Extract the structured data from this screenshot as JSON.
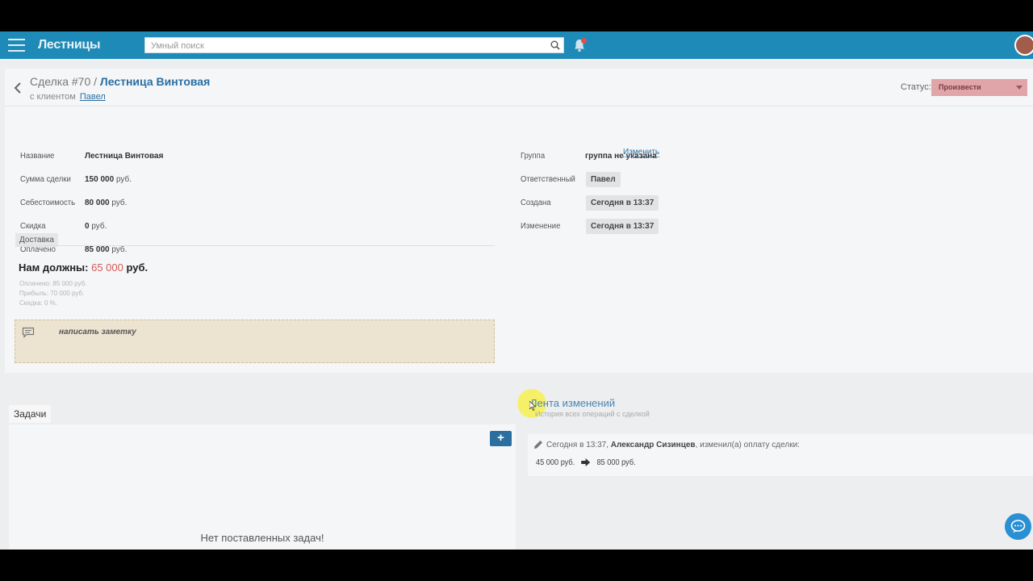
{
  "header": {
    "title": "Лестницы",
    "search_placeholder": "Умный поиск"
  },
  "deal": {
    "title_prefix": "Сделка #70 /",
    "title_name": "Лестница Винтовая",
    "client_label": "с клиентом",
    "client_name": "Павел",
    "status_label": "Статус:",
    "status_value": "Произвести",
    "status_color": "#dfa5a8"
  },
  "fields_left": [
    {
      "label": "Название",
      "value": "Лестница Винтовая",
      "unit": ""
    },
    {
      "label": "Сумма сделки",
      "value": "150 000",
      "unit": "руб."
    },
    {
      "label": "Себестоимость",
      "value": "80 000",
      "unit": "руб."
    },
    {
      "label": "Скидка",
      "value": "0",
      "unit": "руб."
    },
    {
      "label": "Оплачено",
      "value": "85 000",
      "unit": "руб."
    }
  ],
  "fields_right": {
    "group_label": "Группа",
    "group_value": "группа не указана",
    "responsible_label": "Ответственный",
    "responsible_value": "Павел",
    "change_link": "Изменить",
    "created_label": "Создана",
    "created_value": "Сегодня в 13:37",
    "modified_label": "Изменение",
    "modified_value": "Сегодня в 13:37"
  },
  "delivery_tab": "Доставка",
  "summary": {
    "owed_label": "Нам должны:",
    "owed_amount": "65 000",
    "owed_unit": "руб.",
    "paid_line": "Оплачено: 85 000 руб.",
    "profit_line": "Прибыль: 70 000 руб.",
    "discount_line": "Скидка: 0 %."
  },
  "note": {
    "placeholder": "написать заметку"
  },
  "tasks": {
    "tab_label": "Задачи",
    "add_label": "+",
    "empty_text": "Нет поставленных задач!"
  },
  "history": {
    "title": "Лента изменений",
    "subtitle": "История всех операций с сделкой",
    "entry_time": "Сегодня в 13:37,",
    "entry_user": "Александр Сизинцев",
    "entry_action": ", изменил(а) оплату сделки:",
    "from_value": "45 000 руб.",
    "to_value": "85 000 руб."
  },
  "colors": {
    "header_bg": "#1d8ab8",
    "link": "#2b6fa0",
    "owed_amount": "#d45a5a"
  }
}
